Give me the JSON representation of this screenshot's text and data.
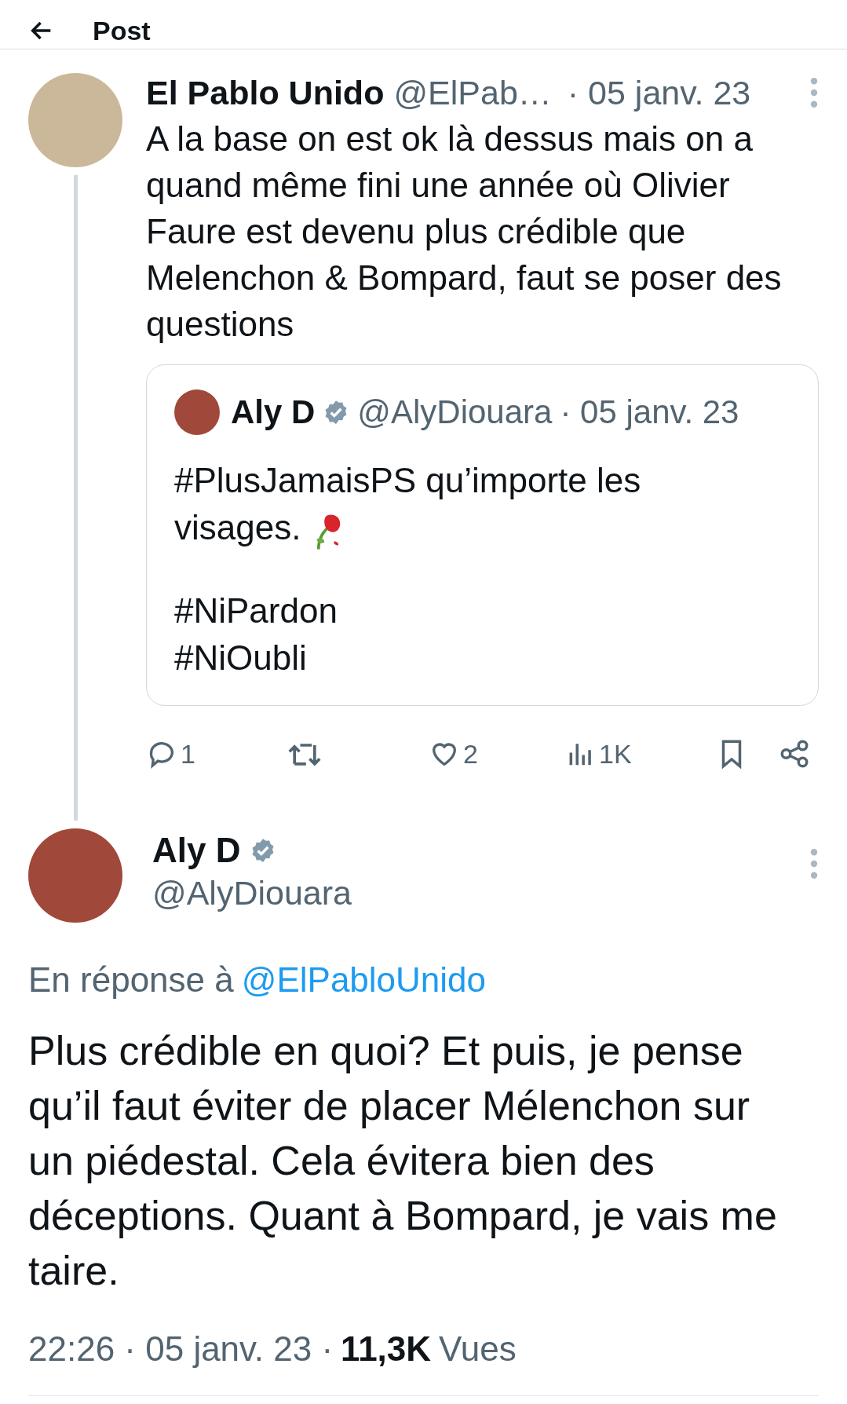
{
  "header": {
    "title": "Post"
  },
  "parent_tweet": {
    "name": "El Pablo Unido",
    "handle": "@ElPab…",
    "date": "· 05 janv. 23",
    "text": "A la base on est ok là dessus mais on a quand même fini une année où Olivier Faure est devenu plus crédible que Melenchon & Bompard, faut se poser des questions",
    "quoted": {
      "name": "Aly D",
      "verified": true,
      "handle": "@AlyDiouara",
      "date": "· 05 janv. 23",
      "lines": [
        "#PlusJamaisPS qu’importe les",
        "visages."
      ],
      "hashtags": [
        "#NiPardon",
        "#NiOubli"
      ]
    },
    "actions": [
      {
        "kind": "reply",
        "count": "1"
      },
      {
        "kind": "repost"
      },
      {
        "kind": "like",
        "count": "2"
      },
      {
        "kind": "views",
        "count": "1K"
      },
      {
        "kind": "bookmark"
      },
      {
        "kind": "share"
      }
    ]
  },
  "main_tweet": {
    "name": "Aly D",
    "verified": true,
    "handle": "@AlyDiouara",
    "reply_prefix": "En réponse à",
    "reply_to": "@ElPabloUnido",
    "text": "Plus crédible en quoi? Et puis, je pense qu’il faut éviter de placer Mélenchon sur un piédestal. Cela évitera bien des déceptions. Quant à Bompard, je vais me taire.",
    "timestamp": "22:26 · 05 janv. 23 ·",
    "views_count": "11,3K",
    "views_label": "Vues"
  }
}
